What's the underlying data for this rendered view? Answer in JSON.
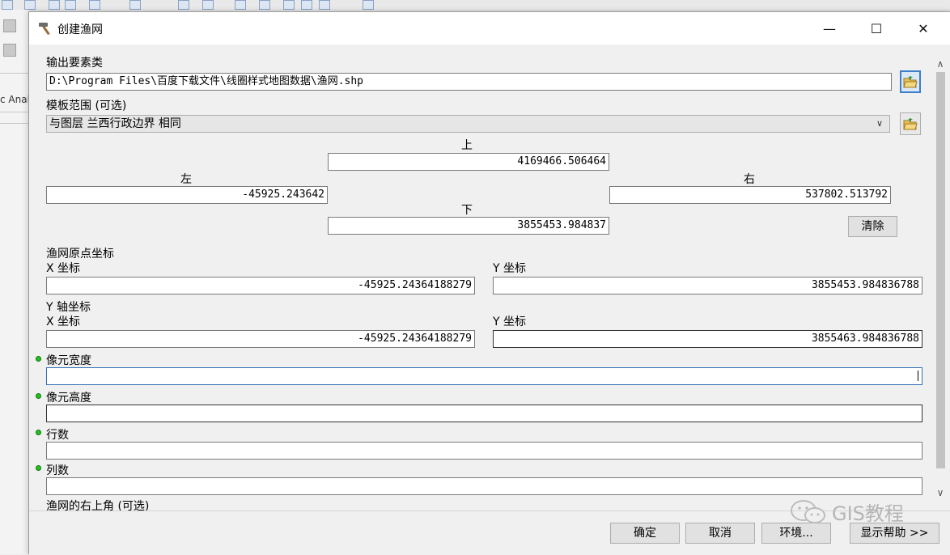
{
  "background": {
    "side_tag": "c Analy"
  },
  "window": {
    "title": "创建渔网",
    "icon": "hammer-icon",
    "controls": [
      "minimize-icon",
      "maximize-icon",
      "close-icon"
    ],
    "minimize_glyph": "—",
    "maximize_glyph": "☐",
    "close_glyph": "✕"
  },
  "output": {
    "label": "输出要素类",
    "value": "D:\\Program Files\\百度下载文件\\线圈样式地图数据\\渔网.shp"
  },
  "template": {
    "label": "模板范围 (可选)",
    "selected": "与图层 兰西行政边界 相同",
    "top_label": "上",
    "top_value": "4169466.506464",
    "left_label": "左",
    "left_value": "-45925.243642",
    "right_label": "右",
    "right_value": "537802.513792",
    "bottom_label": "下",
    "bottom_value": "3855453.984837",
    "clear_label": "清除"
  },
  "origin": {
    "label": "渔网原点坐标",
    "x_label": "X 坐标",
    "x_value": "-45925.24364188279",
    "y_label": "Y 坐标",
    "y_value": "3855453.984836788"
  },
  "yaxis": {
    "label": "Y 轴坐标",
    "x_label": "X 坐标",
    "x_value": "-45925.24364188279",
    "y_label": "Y 坐标",
    "y_value": "3855463.984836788"
  },
  "cell_width": {
    "label": "像元宽度",
    "value": ""
  },
  "cell_height": {
    "label": "像元高度",
    "value": ""
  },
  "rows": {
    "label": "行数",
    "value": ""
  },
  "cols": {
    "label": "列数",
    "value": ""
  },
  "opposite_corner": {
    "label": "渔网的右上角 (可选)"
  },
  "footer": {
    "ok": "确定",
    "cancel": "取消",
    "env": "环境...",
    "help": "显示帮助 >>"
  },
  "watermark": "GIS教程",
  "colors": {
    "required_dot": "#22c01f",
    "focus_border": "#2f6fb0"
  }
}
